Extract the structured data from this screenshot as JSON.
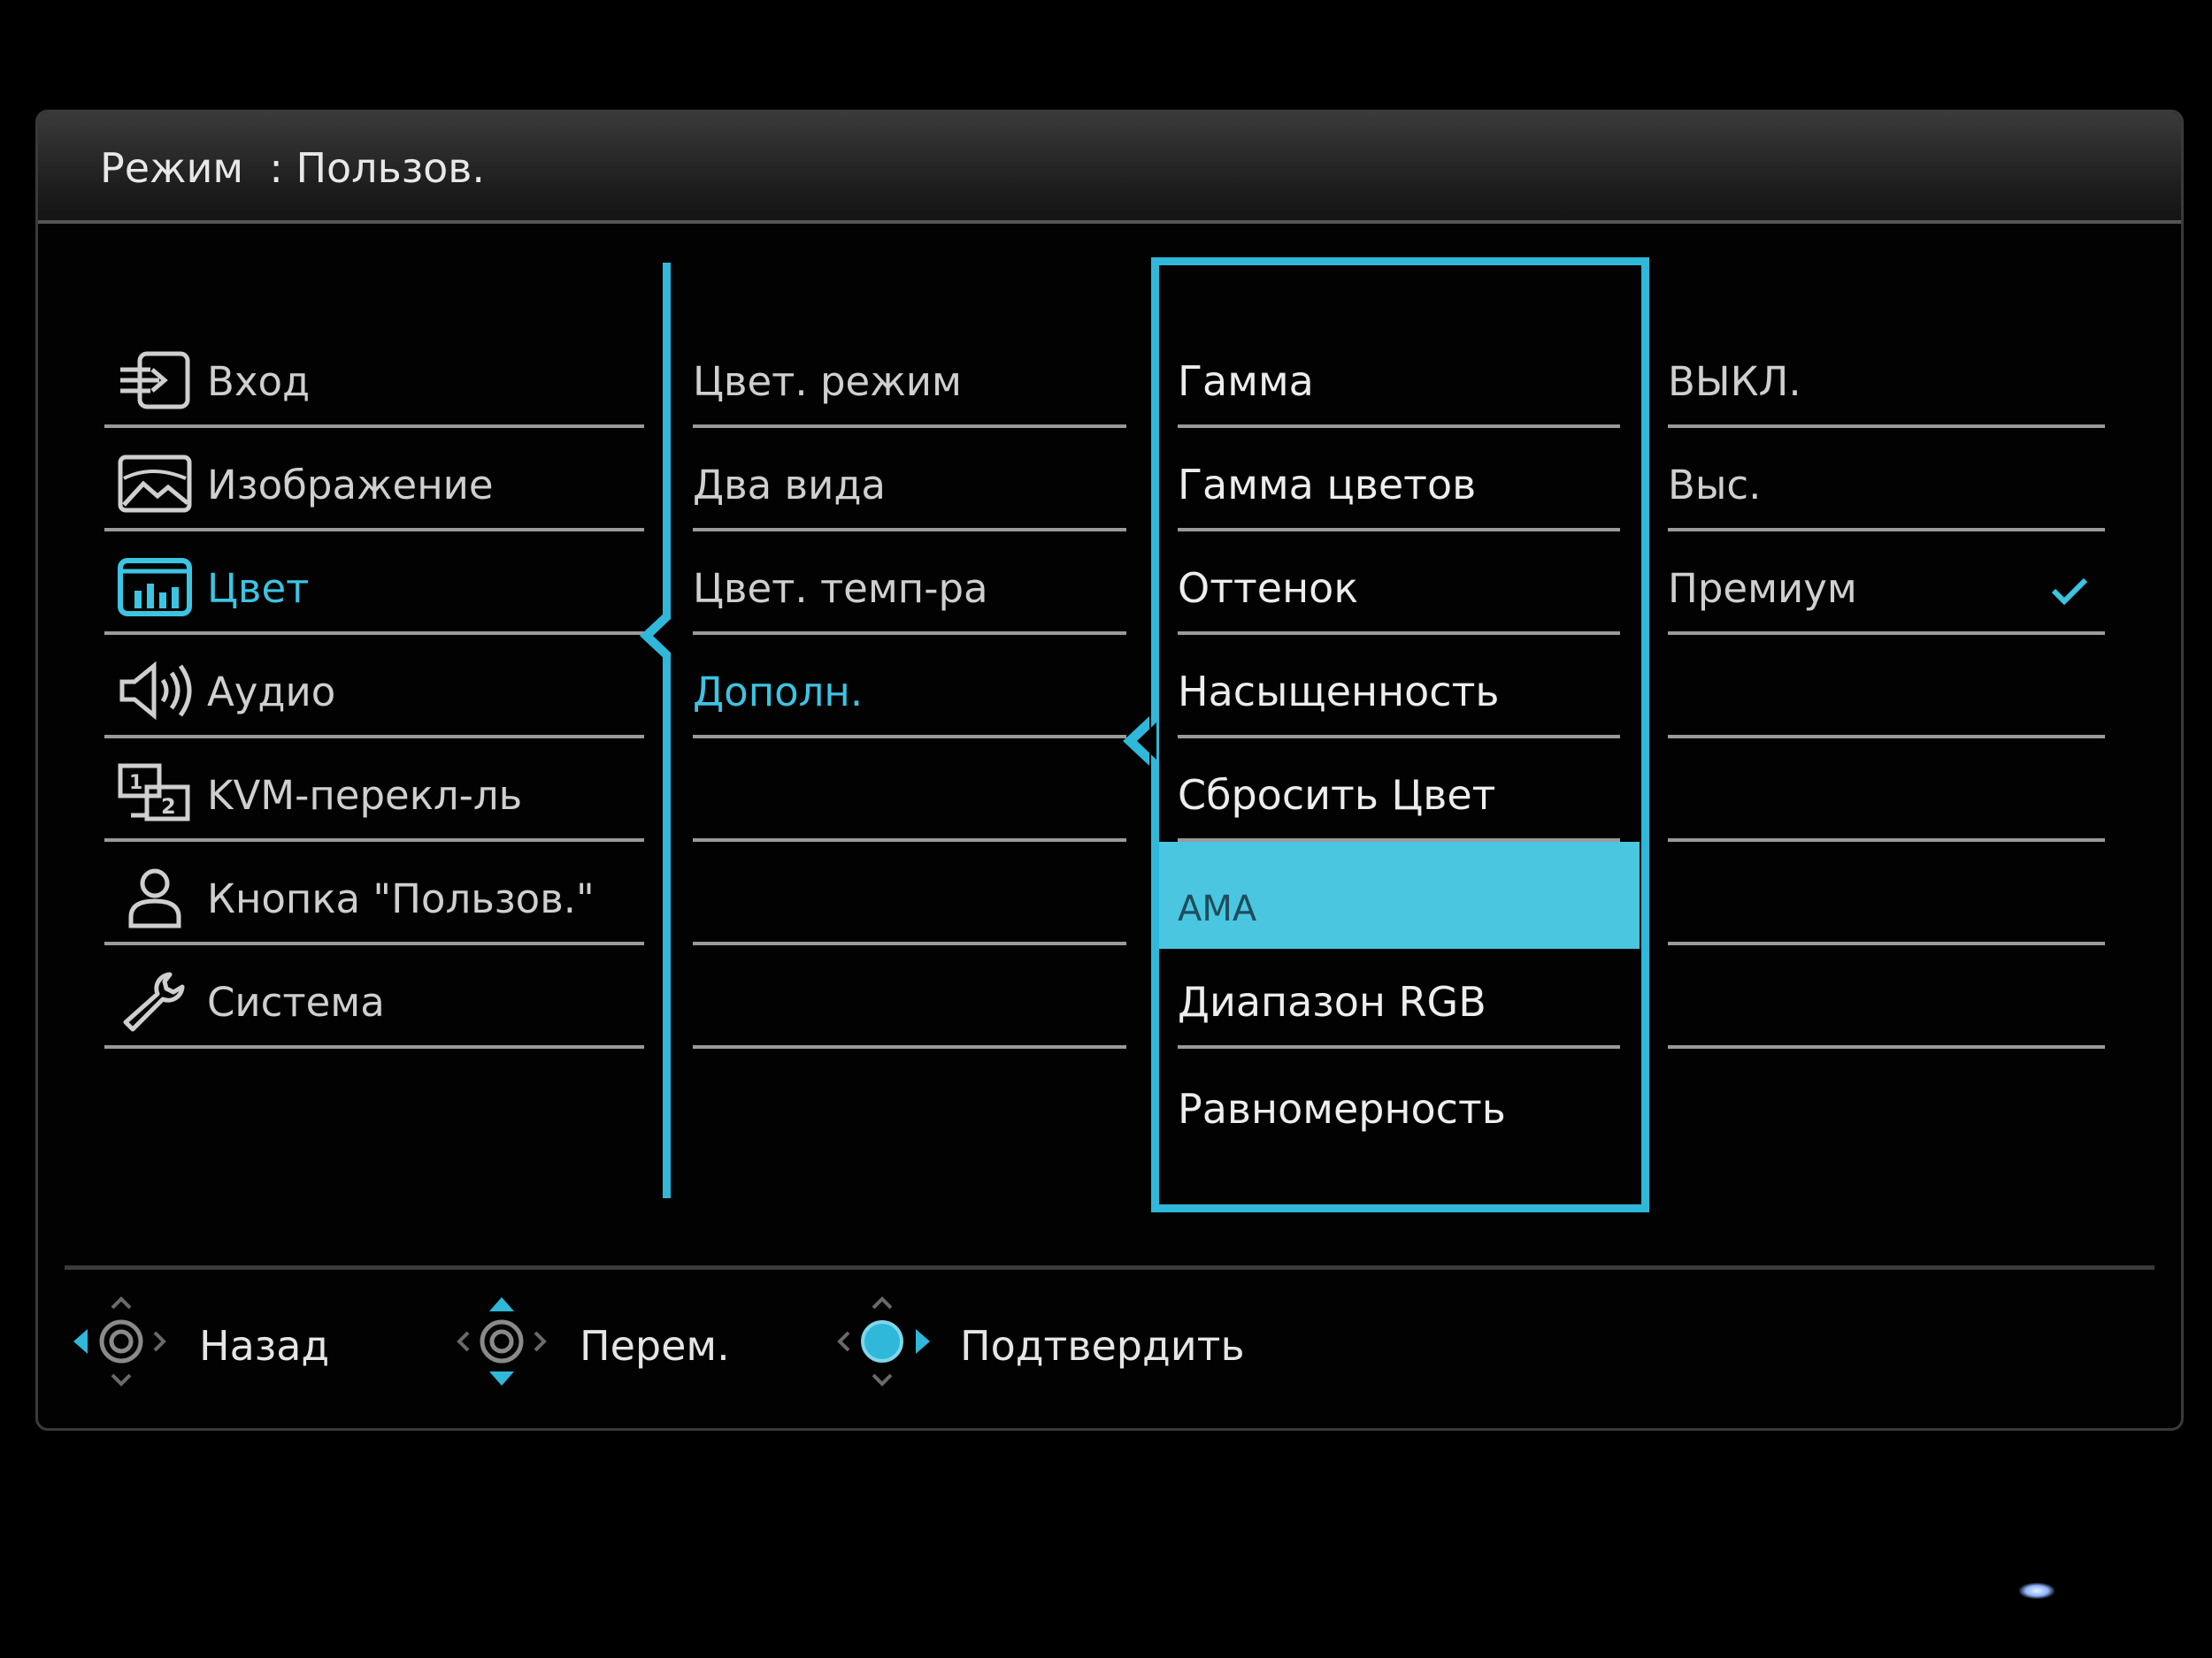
{
  "header": {
    "mode_label": "Режим",
    "separator": ":",
    "mode_value": "Пользов."
  },
  "main_menu": [
    {
      "label": "Вход",
      "icon": "input-icon"
    },
    {
      "label": "Изображение",
      "icon": "picture-icon"
    },
    {
      "label": "Цвет",
      "icon": "color-icon",
      "active": true
    },
    {
      "label": "Аудио",
      "icon": "speaker-icon"
    },
    {
      "label": "KVM-перекл-ль",
      "icon": "kvm-icon"
    },
    {
      "label": "Кнопка \"Пользов.\"",
      "icon": "user-icon"
    },
    {
      "label": "Система",
      "icon": "wrench-icon"
    }
  ],
  "submenu": [
    {
      "label": "Цвет. режим"
    },
    {
      "label": "Два вида"
    },
    {
      "label": "Цвет. темп-ра"
    },
    {
      "label": "Дополн.",
      "active": true
    }
  ],
  "advanced_menu": [
    {
      "label": "Гамма"
    },
    {
      "label": "Гамма цветов"
    },
    {
      "label": "Оттенок"
    },
    {
      "label": "Насыщенность",
      "active": true
    },
    {
      "label": "Сбросить Цвет"
    },
    {
      "label": "AMA",
      "highlighted": true
    },
    {
      "label": "Диапазон RGB"
    },
    {
      "label": "Равномерность"
    }
  ],
  "options": [
    {
      "label": "ВЫКЛ."
    },
    {
      "label": "Выс."
    },
    {
      "label": "Премиум",
      "selected": true
    }
  ],
  "footer": {
    "back": "Назад",
    "move": "Перем.",
    "confirm": "Подтвердить"
  },
  "colors": {
    "accent": "#2fb8d9",
    "highlight": "#4ac6e0",
    "text": "#d7d7d7"
  }
}
